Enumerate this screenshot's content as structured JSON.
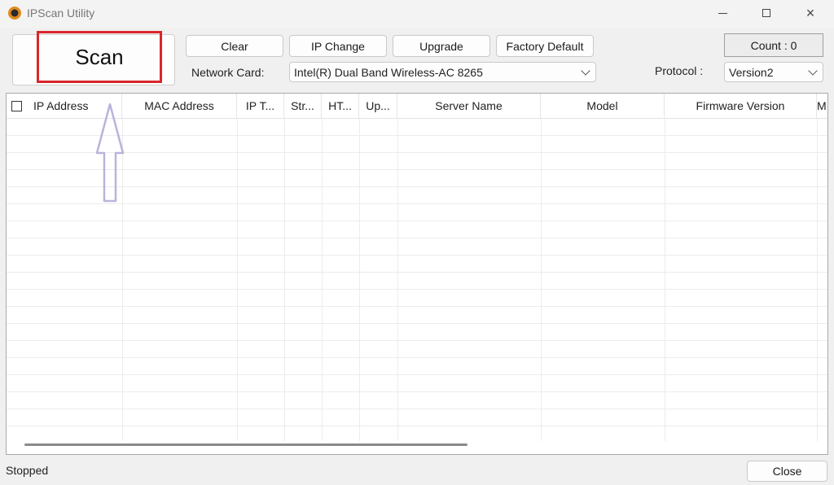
{
  "window": {
    "title": "IPScan Utility",
    "controls": {
      "minimize": "minimize",
      "maximize": "maximize",
      "close": "×"
    }
  },
  "toolbar": {
    "scan_label": "Scan",
    "clear_label": "Clear",
    "ip_change_label": "IP Change",
    "upgrade_label": "Upgrade",
    "factory_default_label": "Factory Default"
  },
  "network_card": {
    "label": "Network Card:",
    "selected": "Intel(R) Dual Band Wireless-AC 8265"
  },
  "protocol": {
    "label": "Protocol :",
    "selected": "Version2"
  },
  "count": {
    "text": "Count : 0"
  },
  "table": {
    "columns": [
      "IP Address",
      "MAC Address",
      "IP T...",
      "Str...",
      "HT...",
      "Up...",
      "Server Name",
      "Model",
      "Firmware Version",
      "M"
    ],
    "rows": []
  },
  "status": {
    "text": "Stopped"
  },
  "footer": {
    "close_label": "Close"
  },
  "colors": {
    "highlight": "#d9252b",
    "arrow": "#b9b4dc"
  },
  "icons": {
    "app": "ipscan-app-icon",
    "annotation": "up-arrow-icon"
  }
}
